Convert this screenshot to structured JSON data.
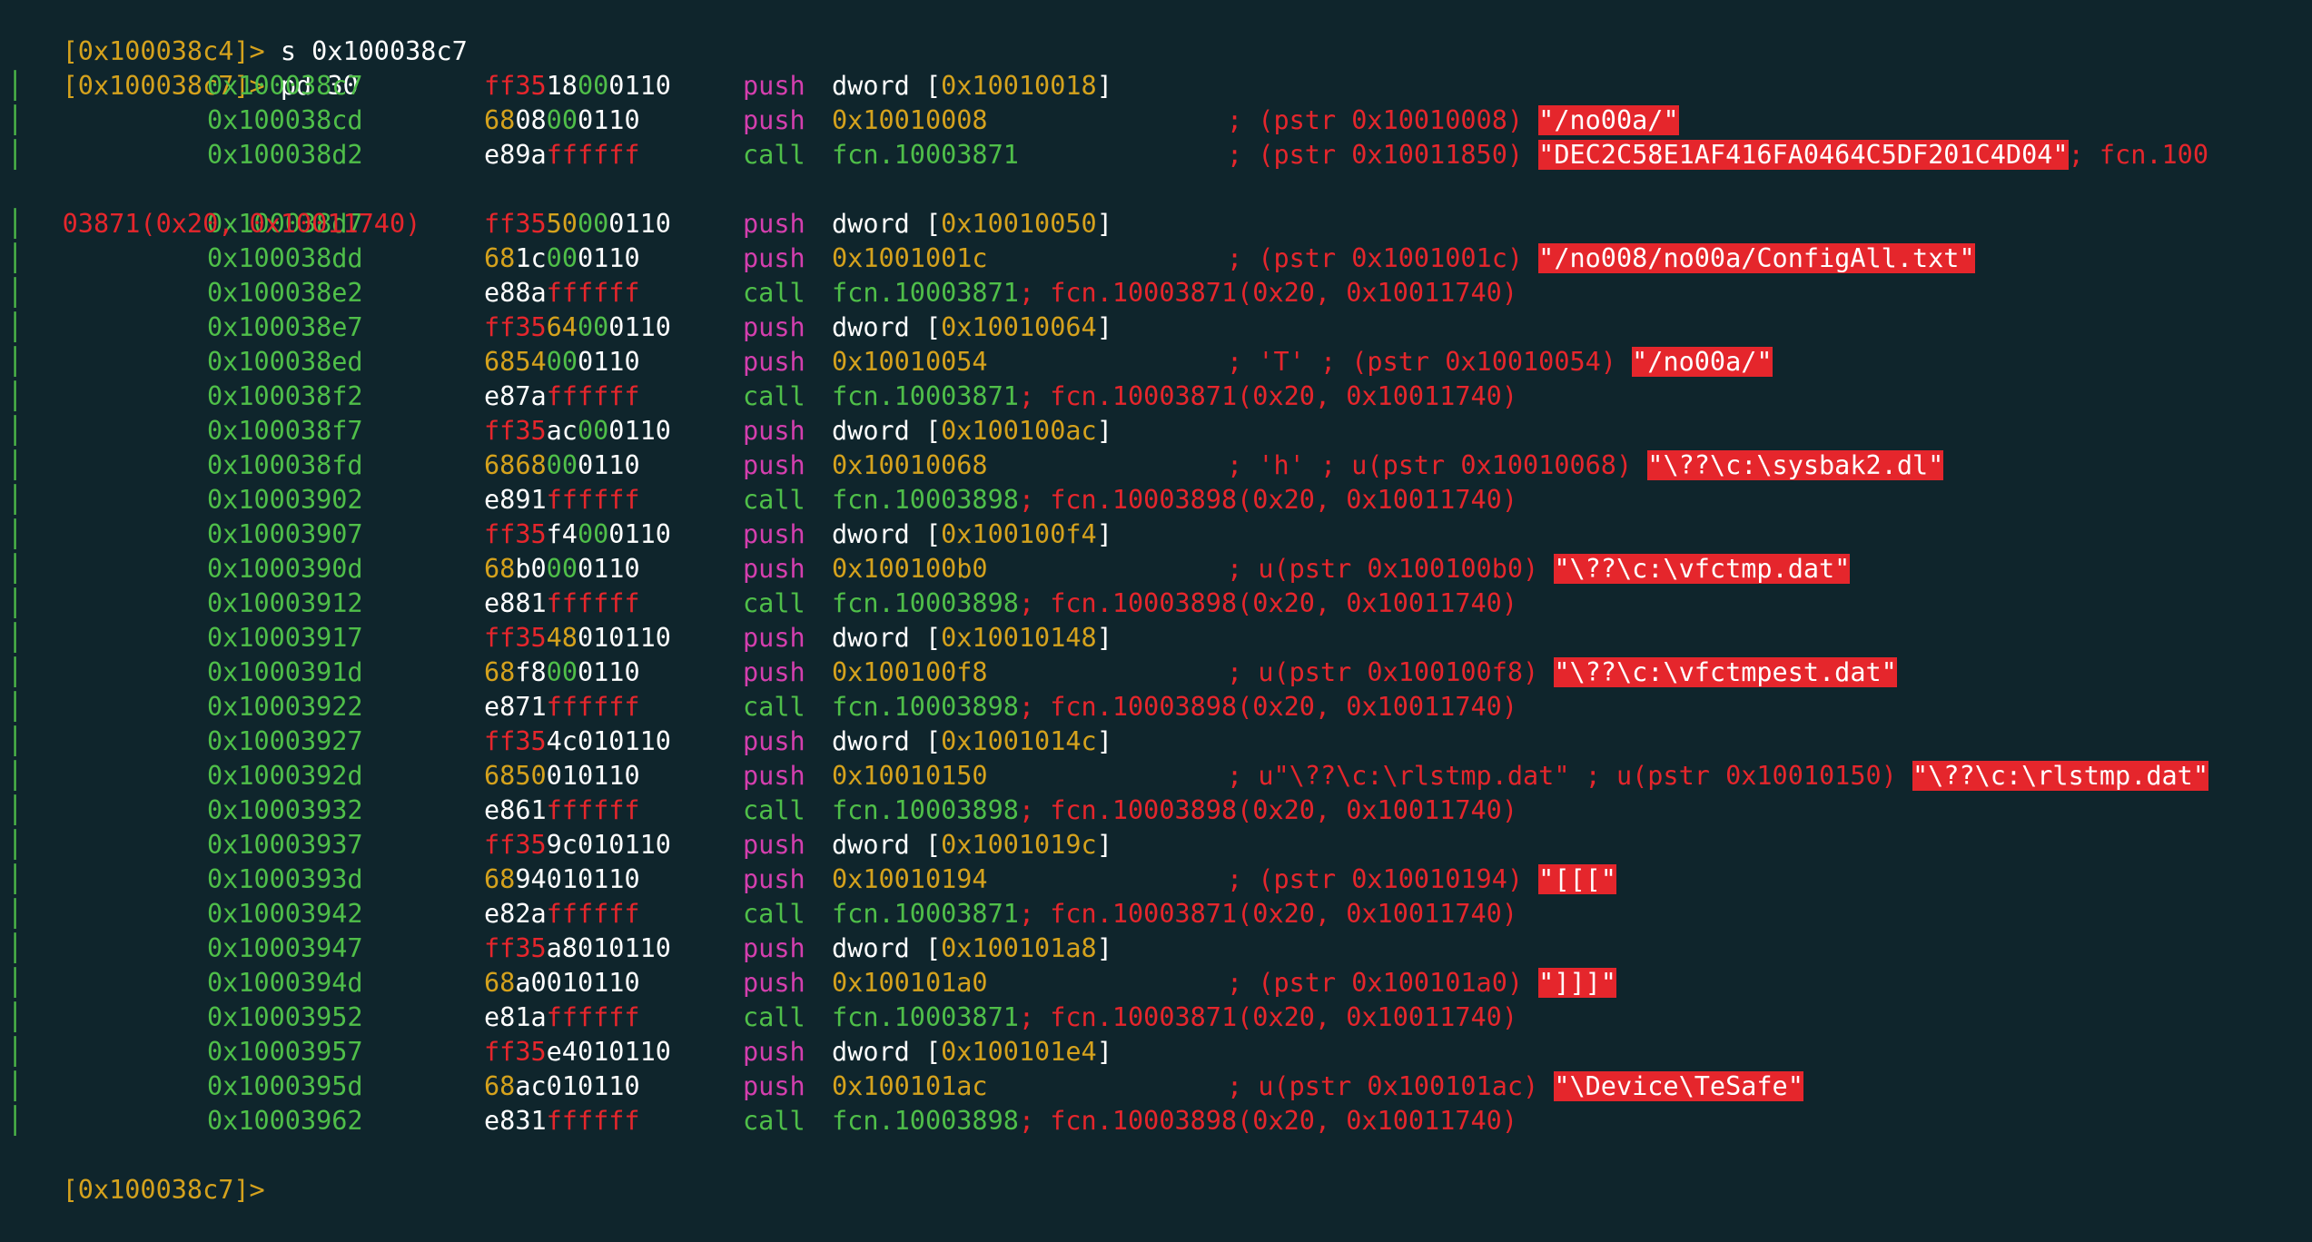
{
  "commands": [
    {
      "prompt": "[0x100038c4]>",
      "input": " s 0x100038c7"
    },
    {
      "prompt": "[0x100038c7]>",
      "input": " pd 30"
    }
  ],
  "final_prompt": "[0x100038c7]>",
  "wrap_line": "03871(0x20, 0x10011740)",
  "rows": [
    {
      "bar": "│",
      "addr": "0x100038c7",
      "bytes": [
        {
          "t": "ff35",
          "c": "r"
        },
        {
          "t": "18",
          "c": "w"
        },
        {
          "t": "00",
          "c": "g"
        },
        {
          "t": "0110",
          "c": "w"
        }
      ],
      "mn": "push",
      "ops": [
        {
          "t": "dword [",
          "c": "w"
        },
        {
          "t": "0x10010018",
          "c": "y"
        },
        {
          "t": "]",
          "c": "w"
        }
      ],
      "cmt": "",
      "str": "",
      "tail": ""
    },
    {
      "bar": "│",
      "addr": "0x100038cd",
      "bytes": [
        {
          "t": "68",
          "c": "y"
        },
        {
          "t": "08",
          "c": "w"
        },
        {
          "t": "00",
          "c": "g"
        },
        {
          "t": "0110",
          "c": "w"
        }
      ],
      "mn": "push",
      "ops": [
        {
          "t": "0x10010008",
          "c": "y"
        }
      ],
      "cmt": "; (pstr 0x10010008) ",
      "str": "\"/no00a/\"",
      "tail": ""
    },
    {
      "bar": "│",
      "addr": "0x100038d2",
      "bytes": [
        {
          "t": "e89a",
          "c": "w"
        },
        {
          "t": "ffffff",
          "c": "r"
        }
      ],
      "mn": "call",
      "ops": [
        {
          "t": "fcn.10003871",
          "c": "g"
        }
      ],
      "cmt": "; (pstr 0x10011850) ",
      "str": "\"DEC2C58E1AF416FA0464C5DF201C4D04\"",
      "tail": "; fcn.100"
    },
    {
      "bar": "│",
      "addr": "0x100038d7",
      "bytes": [
        {
          "t": "ff35",
          "c": "r"
        },
        {
          "t": "50",
          "c": "y"
        },
        {
          "t": "00",
          "c": "g"
        },
        {
          "t": "0110",
          "c": "w"
        }
      ],
      "mn": "push",
      "ops": [
        {
          "t": "dword [",
          "c": "w"
        },
        {
          "t": "0x10010050",
          "c": "y"
        },
        {
          "t": "]",
          "c": "w"
        }
      ],
      "cmt": "",
      "str": "",
      "tail": ""
    },
    {
      "bar": "│",
      "addr": "0x100038dd",
      "bytes": [
        {
          "t": "68",
          "c": "y"
        },
        {
          "t": "1c",
          "c": "w"
        },
        {
          "t": "00",
          "c": "g"
        },
        {
          "t": "0110",
          "c": "w"
        }
      ],
      "mn": "push",
      "ops": [
        {
          "t": "0x1001001c",
          "c": "y"
        }
      ],
      "cmt": "; (pstr 0x1001001c) ",
      "str": "\"/no008/no00a/ConfigAll.txt\"",
      "tail": ""
    },
    {
      "bar": "│",
      "addr": "0x100038e2",
      "bytes": [
        {
          "t": "e88a",
          "c": "w"
        },
        {
          "t": "ffffff",
          "c": "r"
        }
      ],
      "mn": "call",
      "ops": [
        {
          "t": "fcn.10003871",
          "c": "g"
        },
        {
          "t": "; fcn.10003871(0x20, 0x10011740)",
          "c": "r"
        }
      ],
      "cmt": "",
      "str": "",
      "tail": ""
    },
    {
      "bar": "│",
      "addr": "0x100038e7",
      "bytes": [
        {
          "t": "ff35",
          "c": "r"
        },
        {
          "t": "64",
          "c": "y"
        },
        {
          "t": "00",
          "c": "g"
        },
        {
          "t": "0110",
          "c": "w"
        }
      ],
      "mn": "push",
      "ops": [
        {
          "t": "dword [",
          "c": "w"
        },
        {
          "t": "0x10010064",
          "c": "y"
        },
        {
          "t": "]",
          "c": "w"
        }
      ],
      "cmt": "",
      "str": "",
      "tail": ""
    },
    {
      "bar": "│",
      "addr": "0x100038ed",
      "bytes": [
        {
          "t": "68",
          "c": "y"
        },
        {
          "t": "54",
          "c": "y"
        },
        {
          "t": "00",
          "c": "g"
        },
        {
          "t": "0110",
          "c": "w"
        }
      ],
      "mn": "push",
      "ops": [
        {
          "t": "0x10010054",
          "c": "y"
        }
      ],
      "cmt": "; 'T' ; (pstr 0x10010054) ",
      "str": "\"/no00a/\"",
      "tail": ""
    },
    {
      "bar": "│",
      "addr": "0x100038f2",
      "bytes": [
        {
          "t": "e87a",
          "c": "w"
        },
        {
          "t": "ffffff",
          "c": "r"
        }
      ],
      "mn": "call",
      "ops": [
        {
          "t": "fcn.10003871",
          "c": "g"
        },
        {
          "t": "; fcn.10003871(0x20, 0x10011740)",
          "c": "r"
        }
      ],
      "cmt": "",
      "str": "",
      "tail": ""
    },
    {
      "bar": "│",
      "addr": "0x100038f7",
      "bytes": [
        {
          "t": "ff35",
          "c": "r"
        },
        {
          "t": "ac",
          "c": "w"
        },
        {
          "t": "00",
          "c": "g"
        },
        {
          "t": "0110",
          "c": "w"
        }
      ],
      "mn": "push",
      "ops": [
        {
          "t": "dword [",
          "c": "w"
        },
        {
          "t": "0x100100ac",
          "c": "y"
        },
        {
          "t": "]",
          "c": "w"
        }
      ],
      "cmt": "",
      "str": "",
      "tail": ""
    },
    {
      "bar": "│",
      "addr": "0x100038fd",
      "bytes": [
        {
          "t": "68",
          "c": "y"
        },
        {
          "t": "68",
          "c": "y"
        },
        {
          "t": "00",
          "c": "g"
        },
        {
          "t": "0110",
          "c": "w"
        }
      ],
      "mn": "push",
      "ops": [
        {
          "t": "0x10010068",
          "c": "y"
        }
      ],
      "cmt": "; 'h' ; u(pstr 0x10010068) ",
      "str": "\"\\??\\c:\\sysbak2.dl\"",
      "tail": ""
    },
    {
      "bar": "│",
      "addr": "0x10003902",
      "bytes": [
        {
          "t": "e891",
          "c": "w"
        },
        {
          "t": "ffffff",
          "c": "r"
        }
      ],
      "mn": "call",
      "ops": [
        {
          "t": "fcn.10003898",
          "c": "g"
        },
        {
          "t": "; fcn.10003898(0x20, 0x10011740)",
          "c": "r"
        }
      ],
      "cmt": "",
      "str": "",
      "tail": ""
    },
    {
      "bar": "│",
      "addr": "0x10003907",
      "bytes": [
        {
          "t": "ff35",
          "c": "r"
        },
        {
          "t": "f4",
          "c": "w"
        },
        {
          "t": "00",
          "c": "g"
        },
        {
          "t": "0110",
          "c": "w"
        }
      ],
      "mn": "push",
      "ops": [
        {
          "t": "dword [",
          "c": "w"
        },
        {
          "t": "0x100100f4",
          "c": "y"
        },
        {
          "t": "]",
          "c": "w"
        }
      ],
      "cmt": "",
      "str": "",
      "tail": ""
    },
    {
      "bar": "│",
      "addr": "0x1000390d",
      "bytes": [
        {
          "t": "68",
          "c": "y"
        },
        {
          "t": "b0",
          "c": "w"
        },
        {
          "t": "00",
          "c": "g"
        },
        {
          "t": "0110",
          "c": "w"
        }
      ],
      "mn": "push",
      "ops": [
        {
          "t": "0x100100b0",
          "c": "y"
        }
      ],
      "cmt": "; u(pstr 0x100100b0) ",
      "str": "\"\\??\\c:\\vfctmp.dat\"",
      "tail": ""
    },
    {
      "bar": "│",
      "addr": "0x10003912",
      "bytes": [
        {
          "t": "e881",
          "c": "w"
        },
        {
          "t": "ffffff",
          "c": "r"
        }
      ],
      "mn": "call",
      "ops": [
        {
          "t": "fcn.10003898",
          "c": "g"
        },
        {
          "t": "; fcn.10003898(0x20, 0x10011740)",
          "c": "r"
        }
      ],
      "cmt": "",
      "str": "",
      "tail": ""
    },
    {
      "bar": "│",
      "addr": "0x10003917",
      "bytes": [
        {
          "t": "ff35",
          "c": "r"
        },
        {
          "t": "48",
          "c": "y"
        },
        {
          "t": "010110",
          "c": "w"
        }
      ],
      "mn": "push",
      "ops": [
        {
          "t": "dword [",
          "c": "w"
        },
        {
          "t": "0x10010148",
          "c": "y"
        },
        {
          "t": "]",
          "c": "w"
        }
      ],
      "cmt": "",
      "str": "",
      "tail": ""
    },
    {
      "bar": "│",
      "addr": "0x1000391d",
      "bytes": [
        {
          "t": "68",
          "c": "y"
        },
        {
          "t": "f8",
          "c": "w"
        },
        {
          "t": "00",
          "c": "g"
        },
        {
          "t": "0110",
          "c": "w"
        }
      ],
      "mn": "push",
      "ops": [
        {
          "t": "0x100100f8",
          "c": "y"
        }
      ],
      "cmt": "; u(pstr 0x100100f8) ",
      "str": "\"\\??\\c:\\vfctmpest.dat\"",
      "tail": ""
    },
    {
      "bar": "│",
      "addr": "0x10003922",
      "bytes": [
        {
          "t": "e871",
          "c": "w"
        },
        {
          "t": "ffffff",
          "c": "r"
        }
      ],
      "mn": "call",
      "ops": [
        {
          "t": "fcn.10003898",
          "c": "g"
        },
        {
          "t": "; fcn.10003898(0x20, 0x10011740)",
          "c": "r"
        }
      ],
      "cmt": "",
      "str": "",
      "tail": ""
    },
    {
      "bar": "│",
      "addr": "0x10003927",
      "bytes": [
        {
          "t": "ff35",
          "c": "r"
        },
        {
          "t": "4c",
          "c": "w"
        },
        {
          "t": "010110",
          "c": "w"
        }
      ],
      "mn": "push",
      "ops": [
        {
          "t": "dword [",
          "c": "w"
        },
        {
          "t": "0x1001014c",
          "c": "y"
        },
        {
          "t": "]",
          "c": "w"
        }
      ],
      "cmt": "",
      "str": "",
      "tail": ""
    },
    {
      "bar": "│",
      "addr": "0x1000392d",
      "bytes": [
        {
          "t": "68",
          "c": "y"
        },
        {
          "t": "50",
          "c": "y"
        },
        {
          "t": "010110",
          "c": "w"
        }
      ],
      "mn": "push",
      "ops": [
        {
          "t": "0x10010150",
          "c": "y"
        }
      ],
      "cmt": "; u\"\\??\\c:\\rlstmp.dat\" ; u(pstr 0x10010150) ",
      "str": "\"\\??\\c:\\rlstmp.dat\"",
      "tail": ""
    },
    {
      "bar": "│",
      "addr": "0x10003932",
      "bytes": [
        {
          "t": "e861",
          "c": "w"
        },
        {
          "t": "ffffff",
          "c": "r"
        }
      ],
      "mn": "call",
      "ops": [
        {
          "t": "fcn.10003898",
          "c": "g"
        },
        {
          "t": "; fcn.10003898(0x20, 0x10011740)",
          "c": "r"
        }
      ],
      "cmt": "",
      "str": "",
      "tail": ""
    },
    {
      "bar": "│",
      "addr": "0x10003937",
      "bytes": [
        {
          "t": "ff35",
          "c": "r"
        },
        {
          "t": "9c",
          "c": "w"
        },
        {
          "t": "010110",
          "c": "w"
        }
      ],
      "mn": "push",
      "ops": [
        {
          "t": "dword [",
          "c": "w"
        },
        {
          "t": "0x1001019c",
          "c": "y"
        },
        {
          "t": "]",
          "c": "w"
        }
      ],
      "cmt": "",
      "str": "",
      "tail": ""
    },
    {
      "bar": "│",
      "addr": "0x1000393d",
      "bytes": [
        {
          "t": "68",
          "c": "y"
        },
        {
          "t": "94",
          "c": "w"
        },
        {
          "t": "010110",
          "c": "w"
        }
      ],
      "mn": "push",
      "ops": [
        {
          "t": "0x10010194",
          "c": "y"
        }
      ],
      "cmt": "; (pstr 0x10010194) ",
      "str": "\"[[[\"",
      "tail": ""
    },
    {
      "bar": "│",
      "addr": "0x10003942",
      "bytes": [
        {
          "t": "e82a",
          "c": "w"
        },
        {
          "t": "ffffff",
          "c": "r"
        }
      ],
      "mn": "call",
      "ops": [
        {
          "t": "fcn.10003871",
          "c": "g"
        },
        {
          "t": "; fcn.10003871(0x20, 0x10011740)",
          "c": "r"
        }
      ],
      "cmt": "",
      "str": "",
      "tail": ""
    },
    {
      "bar": "│",
      "addr": "0x10003947",
      "bytes": [
        {
          "t": "ff35",
          "c": "r"
        },
        {
          "t": "a8",
          "c": "w"
        },
        {
          "t": "010110",
          "c": "w"
        }
      ],
      "mn": "push",
      "ops": [
        {
          "t": "dword [",
          "c": "w"
        },
        {
          "t": "0x100101a8",
          "c": "y"
        },
        {
          "t": "]",
          "c": "w"
        }
      ],
      "cmt": "",
      "str": "",
      "tail": ""
    },
    {
      "bar": "│",
      "addr": "0x1000394d",
      "bytes": [
        {
          "t": "68",
          "c": "y"
        },
        {
          "t": "a0",
          "c": "w"
        },
        {
          "t": "010110",
          "c": "w"
        }
      ],
      "mn": "push",
      "ops": [
        {
          "t": "0x100101a0",
          "c": "y"
        }
      ],
      "cmt": "; (pstr 0x100101a0) ",
      "str": "\"]]]\"",
      "tail": ""
    },
    {
      "bar": "│",
      "addr": "0x10003952",
      "bytes": [
        {
          "t": "e81a",
          "c": "w"
        },
        {
          "t": "ffffff",
          "c": "r"
        }
      ],
      "mn": "call",
      "ops": [
        {
          "t": "fcn.10003871",
          "c": "g"
        },
        {
          "t": "; fcn.10003871(0x20, 0x10011740)",
          "c": "r"
        }
      ],
      "cmt": "",
      "str": "",
      "tail": ""
    },
    {
      "bar": "│",
      "addr": "0x10003957",
      "bytes": [
        {
          "t": "ff35",
          "c": "r"
        },
        {
          "t": "e4",
          "c": "w"
        },
        {
          "t": "010110",
          "c": "w"
        }
      ],
      "mn": "push",
      "ops": [
        {
          "t": "dword [",
          "c": "w"
        },
        {
          "t": "0x100101e4",
          "c": "y"
        },
        {
          "t": "]",
          "c": "w"
        }
      ],
      "cmt": "",
      "str": "",
      "tail": ""
    },
    {
      "bar": "│",
      "addr": "0x1000395d",
      "bytes": [
        {
          "t": "68",
          "c": "y"
        },
        {
          "t": "ac",
          "c": "w"
        },
        {
          "t": "010110",
          "c": "w"
        }
      ],
      "mn": "push",
      "ops": [
        {
          "t": "0x100101ac",
          "c": "y"
        }
      ],
      "cmt": "; u(pstr 0x100101ac) ",
      "str": "\"\\Device\\TeSafe\"",
      "tail": ""
    },
    {
      "bar": "│",
      "addr": "0x10003962",
      "bytes": [
        {
          "t": "e831",
          "c": "w"
        },
        {
          "t": "ffffff",
          "c": "r"
        }
      ],
      "mn": "call",
      "ops": [
        {
          "t": "fcn.10003898",
          "c": "g"
        },
        {
          "t": "; fcn.10003898(0x20, 0x10011740)",
          "c": "r"
        }
      ],
      "cmt": "",
      "str": "",
      "tail": ""
    }
  ]
}
